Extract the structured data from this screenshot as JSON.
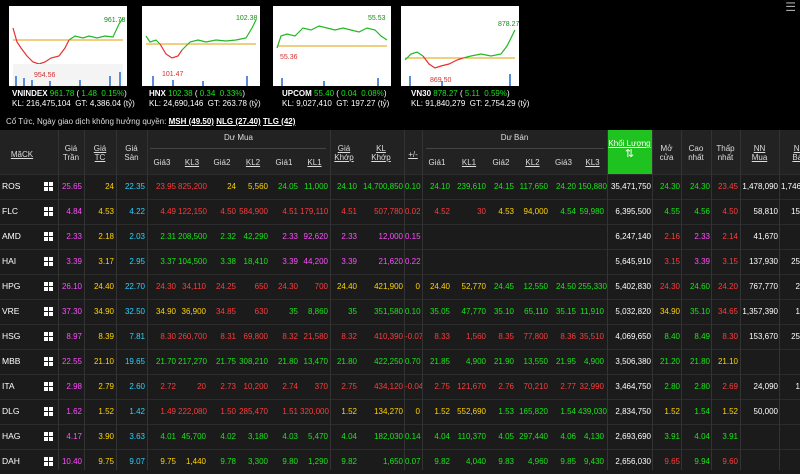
{
  "indices": [
    {
      "name": "VNINDEX",
      "value": "961.78",
      "change": "1.48",
      "pct": "0.15%",
      "kl": "216,475,104",
      "gt": "4,386.04",
      "unit": "(tỷ)",
      "high": "961.78",
      "low": "954.56",
      "dir": "up"
    },
    {
      "name": "HNX",
      "value": "102.38",
      "change": "0.34",
      "pct": "0.33%",
      "kl": "24,690,146",
      "gt": "263.78",
      "unit": "(tỷ)",
      "high": "102.38",
      "low": "101.47",
      "dir": "up"
    },
    {
      "name": "UPCOM",
      "value": "55.40",
      "change": "0.04",
      "pct": "0.08%",
      "kl": "9,027,410",
      "gt": "197.27",
      "unit": "(tỷ)",
      "high": "55.53",
      "low": "55.36",
      "dir": "up"
    },
    {
      "name": "VN30",
      "value": "878.27",
      "change": "5.11",
      "pct": "0.59%",
      "kl": "91,840,279",
      "gt": "2,754.29",
      "unit": "(tỷ)",
      "high": "878.27",
      "low": "869.50",
      "dir": "up"
    }
  ],
  "labels": {
    "kl": "KL:",
    "gt": "GT:"
  },
  "notice": {
    "text": "Cổ Tức, Ngày giao dịch không hưởng quyền:",
    "items": [
      {
        "sym": "MSH",
        "val": "(49.50)"
      },
      {
        "sym": "NLG",
        "val": "(27.40)"
      },
      {
        "sym": "TLG",
        "val": "(42)"
      }
    ]
  },
  "header": {
    "mack": "MãCK",
    "gia_tran": "Giá\nTrần",
    "gia_tc": "Giá\nTC",
    "gia_san": "Giá\nSàn",
    "du_mua": "Dư Mua",
    "du_ban": "Dư Bán",
    "gia3": "Giá3",
    "kl3": "KL3",
    "gia2": "Giá2",
    "kl2": "KL2",
    "gia1": "Giá1",
    "kl1": "KL1",
    "gia_khop": "Giá\nKhớp",
    "kl_khop": "KL\nKhớp",
    "pm": "+/-",
    "khoi_luong": "Khối Lượng",
    "mo_cua": "Mở\ncửa",
    "cao_nhat": "Cao\nnhất",
    "thap_nhat": "Thấp\nnhất",
    "nn_mua": "NN\nMua",
    "nn_ban": "NN\nBán"
  },
  "rows": [
    {
      "sym": "ROS",
      "tran": "25.65",
      "tc": "24",
      "san": "22.35",
      "b": [
        [
          "23.95",
          "825,200",
          "d"
        ],
        [
          "24",
          "5,560",
          "r"
        ],
        [
          "24.05",
          "11,000",
          "u"
        ]
      ],
      "gk": "24.10",
      "klk": "14,700,850",
      "pm": "0.10",
      "c": "u",
      "s": [
        [
          "24.10",
          "239,610",
          "u"
        ],
        [
          "24.15",
          "117,650",
          "u"
        ],
        [
          "24.20",
          "150,880",
          "u"
        ]
      ],
      "kl": "35,471,750",
      "mo": "24.30",
      "mo_c": "u",
      "cao": "24.30",
      "cao_c": "u",
      "thap": "23.45",
      "thap_c": "d",
      "nnm": "1,478,090",
      "nnb": "1,746"
    },
    {
      "sym": "FLC",
      "tran": "4.84",
      "tc": "4.53",
      "san": "4.22",
      "b": [
        [
          "4.49",
          "122,150",
          "d"
        ],
        [
          "4.50",
          "584,900",
          "d"
        ],
        [
          "4.51",
          "179,110",
          "d"
        ]
      ],
      "gk": "4.51",
      "klk": "507,780",
      "pm": "0.02",
      "c": "d",
      "s": [
        [
          "4.52",
          "30",
          "d"
        ],
        [
          "4.53",
          "94,000",
          "r"
        ],
        [
          "4.54",
          "59,980",
          "u"
        ]
      ],
      "kl": "6,395,500",
      "mo": "4.55",
      "mo_c": "u",
      "cao": "4.56",
      "cao_c": "u",
      "thap": "4.50",
      "thap_c": "d",
      "nnm": "58,810",
      "nnb": "15"
    },
    {
      "sym": "AMD",
      "tran": "2.33",
      "tc": "2.18",
      "san": "2.03",
      "b": [
        [
          "2.31",
          "208,500",
          "u"
        ],
        [
          "2.32",
          "42,290",
          "u"
        ],
        [
          "2.33",
          "92,620",
          "c"
        ]
      ],
      "gk": "2.33",
      "klk": "12,000",
      "pm": "0.15",
      "c": "c",
      "s": [
        [
          "",
          "",
          ""
        ],
        [
          "",
          "",
          ""
        ],
        [
          "",
          "",
          ""
        ]
      ],
      "kl": "6,247,140",
      "mo": "2.16",
      "mo_c": "d",
      "cao": "2.33",
      "cao_c": "c",
      "thap": "2.14",
      "thap_c": "d",
      "nnm": "41,670",
      "nnb": ""
    },
    {
      "sym": "HAI",
      "tran": "3.39",
      "tc": "3.17",
      "san": "2.95",
      "b": [
        [
          "3.37",
          "104,500",
          "u"
        ],
        [
          "3.38",
          "18,410",
          "u"
        ],
        [
          "3.39",
          "44,200",
          "c"
        ]
      ],
      "gk": "3.39",
      "klk": "21,620",
      "pm": "0.22",
      "c": "c",
      "s": [
        [
          "",
          "",
          ""
        ],
        [
          "",
          "",
          ""
        ],
        [
          "",
          "",
          ""
        ]
      ],
      "kl": "5,645,910",
      "mo": "3.15",
      "mo_c": "d",
      "cao": "3.39",
      "cao_c": "c",
      "thap": "3.15",
      "thap_c": "d",
      "nnm": "137,930",
      "nnb": "25"
    },
    {
      "sym": "HPG",
      "tran": "26.10",
      "tc": "24.40",
      "san": "22.70",
      "b": [
        [
          "24.30",
          "34,110",
          "d"
        ],
        [
          "24.25",
          "650",
          "d"
        ],
        [
          "24.30",
          "700",
          "d"
        ]
      ],
      "gk": "24.40",
      "klk": "421,900",
      "pm": "0",
      "c": "r",
      "s": [
        [
          "24.40",
          "52,770",
          "r"
        ],
        [
          "24.45",
          "12,550",
          "u"
        ],
        [
          "24.50",
          "255,330",
          "u"
        ]
      ],
      "kl": "5,402,830",
      "mo": "24.30",
      "mo_c": "d",
      "cao": "24.60",
      "cao_c": "u",
      "thap": "24.20",
      "thap_c": "d",
      "nnm": "767,770",
      "nnb": "2"
    },
    {
      "sym": "VRE",
      "tran": "37.30",
      "tc": "34.90",
      "san": "32.50",
      "b": [
        [
          "34.90",
          "36,900",
          "r"
        ],
        [
          "34.85",
          "630",
          "d"
        ],
        [
          "35",
          "8,860",
          "u"
        ]
      ],
      "gk": "35",
      "klk": "351,580",
      "pm": "0.10",
      "c": "u",
      "s": [
        [
          "35.05",
          "47,770",
          "u"
        ],
        [
          "35.10",
          "65,110",
          "u"
        ],
        [
          "35.15",
          "11,910",
          "u"
        ]
      ],
      "kl": "5,032,820",
      "mo": "34.90",
      "mo_c": "r",
      "cao": "35.10",
      "cao_c": "u",
      "thap": "34.65",
      "thap_c": "d",
      "nnm": "1,357,390",
      "nnb": "1"
    },
    {
      "sym": "HSG",
      "tran": "8.97",
      "tc": "8.39",
      "san": "7.81",
      "b": [
        [
          "8.30",
          "260,700",
          "d"
        ],
        [
          "8.31",
          "69,800",
          "d"
        ],
        [
          "8.32",
          "21,580",
          "d"
        ]
      ],
      "gk": "8.32",
      "klk": "410,390",
      "pm": "-0.07",
      "c": "d",
      "s": [
        [
          "8.33",
          "1,560",
          "d"
        ],
        [
          "8.35",
          "77,800",
          "d"
        ],
        [
          "8.36",
          "35,510",
          "d"
        ]
      ],
      "kl": "4,069,650",
      "mo": "8.40",
      "mo_c": "u",
      "cao": "8.49",
      "cao_c": "u",
      "thap": "8.30",
      "thap_c": "d",
      "nnm": "153,670",
      "nnb": "25"
    },
    {
      "sym": "MBB",
      "tran": "22.55",
      "tc": "21.10",
      "san": "19.65",
      "b": [
        [
          "21.70",
          "217,270",
          "u"
        ],
        [
          "21.75",
          "308,210",
          "u"
        ],
        [
          "21.80",
          "13,470",
          "u"
        ]
      ],
      "gk": "21.80",
      "klk": "422,250",
      "pm": "0.70",
      "c": "u",
      "s": [
        [
          "21.85",
          "4,900",
          "u"
        ],
        [
          "21.90",
          "13,550",
          "u"
        ],
        [
          "21.95",
          "4,900",
          "u"
        ]
      ],
      "kl": "3,506,380",
      "mo": "21.20",
      "mo_c": "u",
      "cao": "21.80",
      "cao_c": "u",
      "thap": "21.10",
      "thap_c": "r",
      "nnm": "",
      "nnb": ""
    },
    {
      "sym": "ITA",
      "tran": "2.98",
      "tc": "2.79",
      "san": "2.60",
      "b": [
        [
          "2.72",
          "20",
          "d"
        ],
        [
          "2.73",
          "10,200",
          "d"
        ],
        [
          "2.74",
          "370",
          "d"
        ]
      ],
      "gk": "2.75",
      "klk": "434,120",
      "pm": "-0.04",
      "c": "d",
      "s": [
        [
          "2.75",
          "121,670",
          "d"
        ],
        [
          "2.76",
          "70,210",
          "d"
        ],
        [
          "2.77",
          "32,990",
          "d"
        ]
      ],
      "kl": "3,464,750",
      "mo": "2.80",
      "mo_c": "u",
      "cao": "2.80",
      "cao_c": "u",
      "thap": "2.69",
      "thap_c": "d",
      "nnm": "24,090",
      "nnb": "1"
    },
    {
      "sym": "DLG",
      "tran": "1.62",
      "tc": "1.52",
      "san": "1.42",
      "b": [
        [
          "1.49",
          "222,080",
          "d"
        ],
        [
          "1.50",
          "285,470",
          "d"
        ],
        [
          "1.51",
          "320,000",
          "d"
        ]
      ],
      "gk": "1.52",
      "klk": "134,270",
      "pm": "0",
      "c": "r",
      "s": [
        [
          "1.52",
          "552,690",
          "r"
        ],
        [
          "1.53",
          "165,820",
          "u"
        ],
        [
          "1.54",
          "439,030",
          "u"
        ]
      ],
      "kl": "2,834,750",
      "mo": "1.52",
      "mo_c": "r",
      "cao": "1.54",
      "cao_c": "u",
      "thap": "1.52",
      "thap_c": "r",
      "nnm": "50,000",
      "nnb": ""
    },
    {
      "sym": "HAG",
      "tran": "4.17",
      "tc": "3.90",
      "san": "3.63",
      "b": [
        [
          "4.01",
          "45,700",
          "u"
        ],
        [
          "4.02",
          "3,180",
          "u"
        ],
        [
          "4.03",
          "5,470",
          "u"
        ]
      ],
      "gk": "4.04",
      "klk": "182,030",
      "pm": "0.14",
      "c": "u",
      "s": [
        [
          "4.04",
          "110,370",
          "u"
        ],
        [
          "4.05",
          "297,440",
          "u"
        ],
        [
          "4.06",
          "4,130",
          "u"
        ]
      ],
      "kl": "2,693,690",
      "mo": "3.91",
      "mo_c": "u",
      "cao": "4.04",
      "cao_c": "u",
      "thap": "3.91",
      "thap_c": "u",
      "nnm": "",
      "nnb": ""
    },
    {
      "sym": "DAH",
      "tran": "10.40",
      "tc": "9.75",
      "san": "9.07",
      "b": [
        [
          "9.75",
          "1,440",
          "r"
        ],
        [
          "9.78",
          "3,300",
          "u"
        ],
        [
          "9.80",
          "1,290",
          "u"
        ]
      ],
      "gk": "9.82",
      "klk": "1,650",
      "pm": "0.07",
      "c": "u",
      "s": [
        [
          "9.82",
          "4,040",
          "u"
        ],
        [
          "9.83",
          "4,960",
          "u"
        ],
        [
          "9.85",
          "9,430",
          "u"
        ]
      ],
      "kl": "2,656,030",
      "mo": "9.65",
      "mo_c": "d",
      "cao": "9.94",
      "cao_c": "u",
      "thap": "9.60",
      "thap_c": "d",
      "nnm": "",
      "nnb": ""
    }
  ],
  "colors": {
    "up": "#19e619",
    "down": "#ff3b3b",
    "ref": "#ffd400",
    "ceil": "#ff4dff",
    "floor": "#29d3ff",
    "highlight": "#1fc31f"
  },
  "icons": {
    "menu": "menu-icon",
    "row": "grid-icon"
  }
}
